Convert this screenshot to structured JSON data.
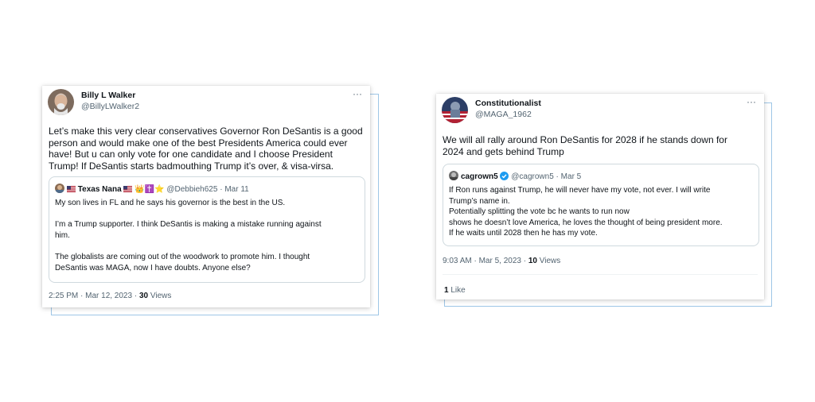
{
  "tweet1": {
    "name": "Billy L Walker",
    "handle": "@BillyLWalker2",
    "more": "···",
    "text": "Let’s make this very clear conservatives Governor Ron DeSantis is a good\nperson and would make one of the best Presidents America could ever\nhave! But u can only vote for one candidate and I choose President\nTrump! If DeSantis starts badmouthing Trump it’s over, & visa-virsa.",
    "quote": {
      "name": "Texas Nana",
      "emoji_after": "👑✝️⭐",
      "handle": "@Debbieh625",
      "sep": "·",
      "date": "Mar 11",
      "text": "My son lives in FL and he says his governor is the best in the US.\n\nI’m a Trump supporter.  I think DeSantis is making a mistake running against\nhim.\n\nThe globalists are coming out of the woodwork to promote him.  I thought\nDeSantis was MAGA, now I have doubts. Anyone else?"
    },
    "meta_time": "2:25 PM · Mar 12, 2023 · ",
    "views_count": "30",
    "views_label": " Views"
  },
  "tweet2": {
    "name": "Constitutionalist",
    "handle": "@MAGA_1962",
    "more": "···",
    "text": "We will all rally around Ron DeSantis for 2028 if he stands down for\n2024 and gets behind Trump",
    "quote": {
      "name": "cagrown5",
      "handle": "@cagrown5",
      "sep": "·",
      "date": "Mar 5",
      "text": "If Ron runs against Trump, he will never have my vote, not ever. I will write\nTrump’s name in.\nPotentially splitting the vote bc he wants to run now\nshows he doesn’t love America, he loves the thought of being president more.\nIf he waits until 2028 then he has my vote."
    },
    "meta_time": "9:03 AM · Mar 5, 2023 · ",
    "views_count": "10",
    "views_label": " Views",
    "likes_count": "1",
    "likes_label": " Like"
  },
  "colors": {
    "accent_blue": "#1d9bf0",
    "secondary_text": "#536471",
    "frame_line": "#9ec6e6"
  },
  "icons": [
    "more-options-icon",
    "verified-badge-icon",
    "us-flag-icon"
  ]
}
